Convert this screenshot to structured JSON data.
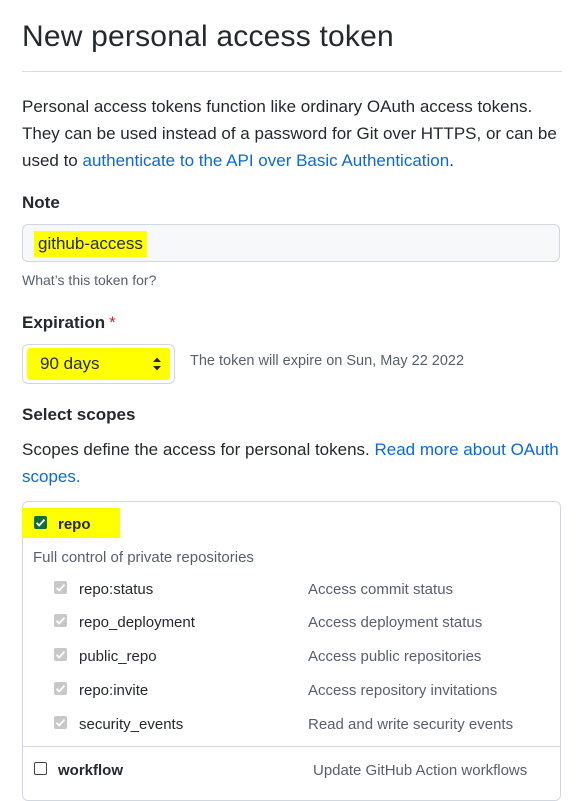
{
  "header": {
    "title": "New personal access token"
  },
  "intro": {
    "text_before_link": "Personal access tokens function like ordinary OAuth access tokens. They can be used instead of a password for Git over HTTPS, or can be used to ",
    "link_text": "authenticate to the API over Basic Authentication",
    "text_after_link": "."
  },
  "note": {
    "label": "Note",
    "value": "github-access",
    "hint": "What’s this token for?"
  },
  "expiration": {
    "label": "Expiration",
    "required_mark": "*",
    "selected": "90 days",
    "message": "The token will expire on Sun, May 22 2022"
  },
  "scopes": {
    "heading": "Select scopes",
    "desc_before_link": "Scopes define the access for personal tokens. ",
    "link_text": "Read more about OAuth scopes.",
    "repo": {
      "name": "repo",
      "checked": true,
      "description": "Full control of private repositories"
    },
    "sub_scopes": [
      {
        "name": "repo:status",
        "description": "Access commit status",
        "checked": true
      },
      {
        "name": "repo_deployment",
        "description": "Access deployment status",
        "checked": true
      },
      {
        "name": "public_repo",
        "description": "Access public repositories",
        "checked": true
      },
      {
        "name": "repo:invite",
        "description": "Access repository invitations",
        "checked": true
      },
      {
        "name": "security_events",
        "description": "Read and write security events",
        "checked": true
      }
    ],
    "workflow": {
      "name": "workflow",
      "checked": false,
      "description": "Update GitHub Action workflows"
    }
  },
  "colors": {
    "link": "#0969da",
    "highlight": "#ffff00",
    "required": "#cf222e",
    "checkbox_checked": "#0f6e3a",
    "checkbox_disabled": "#c8c8c8"
  },
  "icons": {
    "select_arrows": "updown-chevron-icon",
    "checkmark": "checkmark-icon"
  }
}
